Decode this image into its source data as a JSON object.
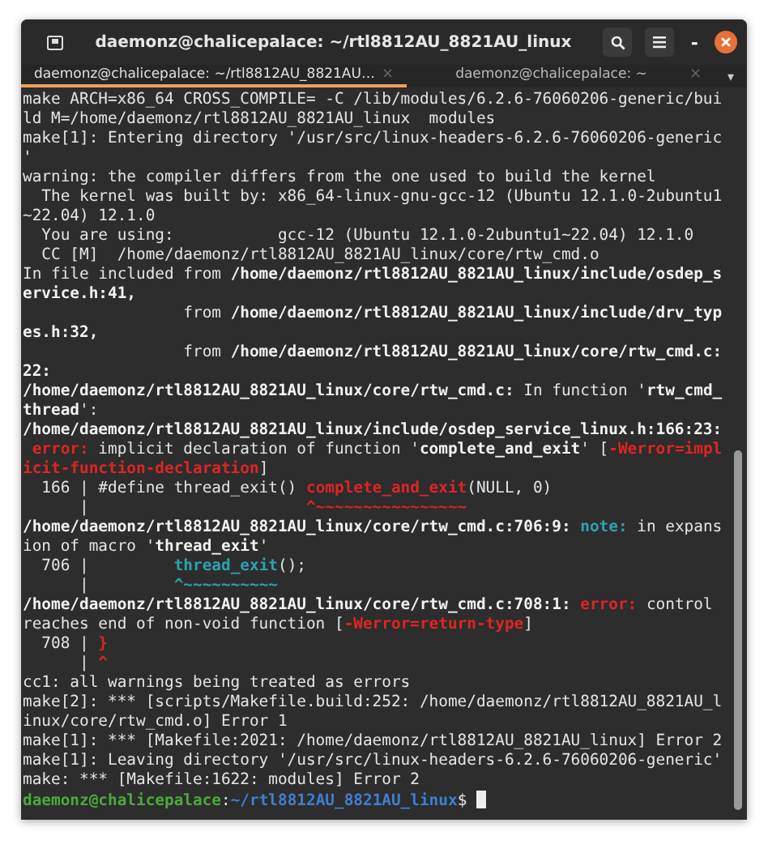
{
  "window": {
    "title": "daemonz@chalicepalace: ~/rtl8812AU_8821AU_linux"
  },
  "tabs": [
    {
      "label": "daemonz@chalicepalace: ~/rtl8812AU_8821AU…",
      "close": "×",
      "selected": true
    },
    {
      "label": "daemonz@chalicepalace: ~",
      "close": "×",
      "selected": false
    }
  ],
  "tab_menu": "▾",
  "minimize": "-",
  "terminal": {
    "lines": [
      [
        {
          "kind": "plain",
          "text": "make ARCH=x86_64 CROSS_COMPILE= -C /lib/modules/6.2.6-76060206-generic/bui"
        }
      ],
      [
        {
          "kind": "plain",
          "text": "ld M=/home/daemonz/rtl8812AU_8821AU_linux  modules"
        }
      ],
      [
        {
          "kind": "plain",
          "text": "make[1]: Entering directory '/usr/src/linux-headers-6.2.6-76060206-generic"
        }
      ],
      [
        {
          "kind": "plain",
          "text": "'"
        }
      ],
      [
        {
          "kind": "plain",
          "text": "warning: the compiler differs from the one used to build the kernel"
        }
      ],
      [
        {
          "kind": "plain",
          "text": "  The kernel was built by: x86_64-linux-gnu-gcc-12 (Ubuntu 12.1.0-2ubuntu1"
        }
      ],
      [
        {
          "kind": "plain",
          "text": "~22.04) 12.1.0"
        }
      ],
      [
        {
          "kind": "plain",
          "text": "  You are using:           gcc-12 (Ubuntu 12.1.0-2ubuntu1~22.04) 12.1.0"
        }
      ],
      [
        {
          "kind": "plain",
          "text": "  CC [M]  /home/daemonz/rtl8812AU_8821AU_linux/core/rtw_cmd.o"
        }
      ],
      [
        {
          "kind": "plain",
          "text": "In file included from "
        },
        {
          "kind": "bold",
          "text": "/home/daemonz/rtl8812AU_8821AU_linux/include/osdep_s"
        }
      ],
      [
        {
          "kind": "bold",
          "text": "ervice.h:41,"
        }
      ],
      [
        {
          "kind": "plain",
          "text": "                 from "
        },
        {
          "kind": "bold",
          "text": "/home/daemonz/rtl8812AU_8821AU_linux/include/drv_typ"
        }
      ],
      [
        {
          "kind": "bold",
          "text": "es.h:32,"
        }
      ],
      [
        {
          "kind": "plain",
          "text": "                 from "
        },
        {
          "kind": "bold",
          "text": "/home/daemonz/rtl8812AU_8821AU_linux/core/rtw_cmd.c:"
        }
      ],
      [
        {
          "kind": "bold",
          "text": "22:"
        }
      ],
      [
        {
          "kind": "bold",
          "text": "/home/daemonz/rtl8812AU_8821AU_linux/core/rtw_cmd.c:"
        },
        {
          "kind": "plain",
          "text": " In function '"
        },
        {
          "kind": "bold",
          "text": "rtw_cmd_"
        }
      ],
      [
        {
          "kind": "bold",
          "text": "thread"
        },
        {
          "kind": "plain",
          "text": "':"
        }
      ],
      [
        {
          "kind": "bold",
          "text": "/home/daemonz/rtl8812AU_8821AU_linux/include/osdep_service_linux.h:166:23:"
        }
      ],
      [
        {
          "kind": "error",
          "text": " error:"
        },
        {
          "kind": "plain",
          "text": " implicit declaration of function '"
        },
        {
          "kind": "bold",
          "text": "complete_and_exit"
        },
        {
          "kind": "plain",
          "text": "' ["
        },
        {
          "kind": "error",
          "text": "-Werror=impl"
        }
      ],
      [
        {
          "kind": "error",
          "text": "icit-function-declaration"
        },
        {
          "kind": "plain",
          "text": "]"
        }
      ],
      [
        {
          "kind": "plain",
          "text": "  166 | #define thread_exit() "
        },
        {
          "kind": "error",
          "text": "complete_and_exit"
        },
        {
          "kind": "plain",
          "text": "(NULL, 0)"
        }
      ],
      [
        {
          "kind": "plain",
          "text": "      |                       "
        },
        {
          "kind": "error",
          "text": "^~~~~~~~~~~~~~~~~"
        }
      ],
      [
        {
          "kind": "bold",
          "text": "/home/daemonz/rtl8812AU_8821AU_linux/core/rtw_cmd.c:706:9:"
        },
        {
          "kind": "note",
          "text": " note:"
        },
        {
          "kind": "plain",
          "text": " in expans"
        }
      ],
      [
        {
          "kind": "plain",
          "text": "ion of macro '"
        },
        {
          "kind": "bold",
          "text": "thread_exit"
        },
        {
          "kind": "plain",
          "text": "'"
        }
      ],
      [
        {
          "kind": "plain",
          "text": "  706 |         "
        },
        {
          "kind": "code",
          "text": "thread_exit"
        },
        {
          "kind": "plain",
          "text": "();"
        }
      ],
      [
        {
          "kind": "plain",
          "text": "      |         "
        },
        {
          "kind": "code",
          "text": "^~~~~~~~~~~"
        }
      ],
      [
        {
          "kind": "bold",
          "text": "/home/daemonz/rtl8812AU_8821AU_linux/core/rtw_cmd.c:708:1:"
        },
        {
          "kind": "error",
          "text": " error:"
        },
        {
          "kind": "plain",
          "text": " control"
        }
      ],
      [
        {
          "kind": "plain",
          "text": "reaches end of non-void function ["
        },
        {
          "kind": "error",
          "text": "-Werror=return-type"
        },
        {
          "kind": "plain",
          "text": "]"
        }
      ],
      [
        {
          "kind": "plain",
          "text": "  708 | "
        },
        {
          "kind": "error",
          "text": "}"
        }
      ],
      [
        {
          "kind": "plain",
          "text": "      | "
        },
        {
          "kind": "error",
          "text": "^"
        }
      ],
      [
        {
          "kind": "plain",
          "text": "cc1: all warnings being treated as errors"
        }
      ],
      [
        {
          "kind": "plain",
          "text": "make[2]: *** [scripts/Makefile.build:252: /home/daemonz/rtl8812AU_8821AU_l"
        }
      ],
      [
        {
          "kind": "plain",
          "text": "inux/core/rtw_cmd.o] Error 1"
        }
      ],
      [
        {
          "kind": "plain",
          "text": "make[1]: *** [Makefile:2021: /home/daemonz/rtl8812AU_8821AU_linux] Error 2"
        }
      ],
      [
        {
          "kind": "plain",
          "text": "make[1]: Leaving directory '/usr/src/linux-headers-6.2.6-76060206-generic'"
        }
      ],
      [
        {
          "kind": "plain",
          "text": "make: *** [Makefile:1622: modules] Error 2"
        }
      ],
      [
        {
          "kind": "user",
          "text": "daemonz@chalicepalace"
        },
        {
          "kind": "plain",
          "text": ":"
        },
        {
          "kind": "path",
          "text": "~/rtl8812AU_8821AU_linux"
        },
        {
          "kind": "plain",
          "text": "$ "
        }
      ]
    ]
  }
}
